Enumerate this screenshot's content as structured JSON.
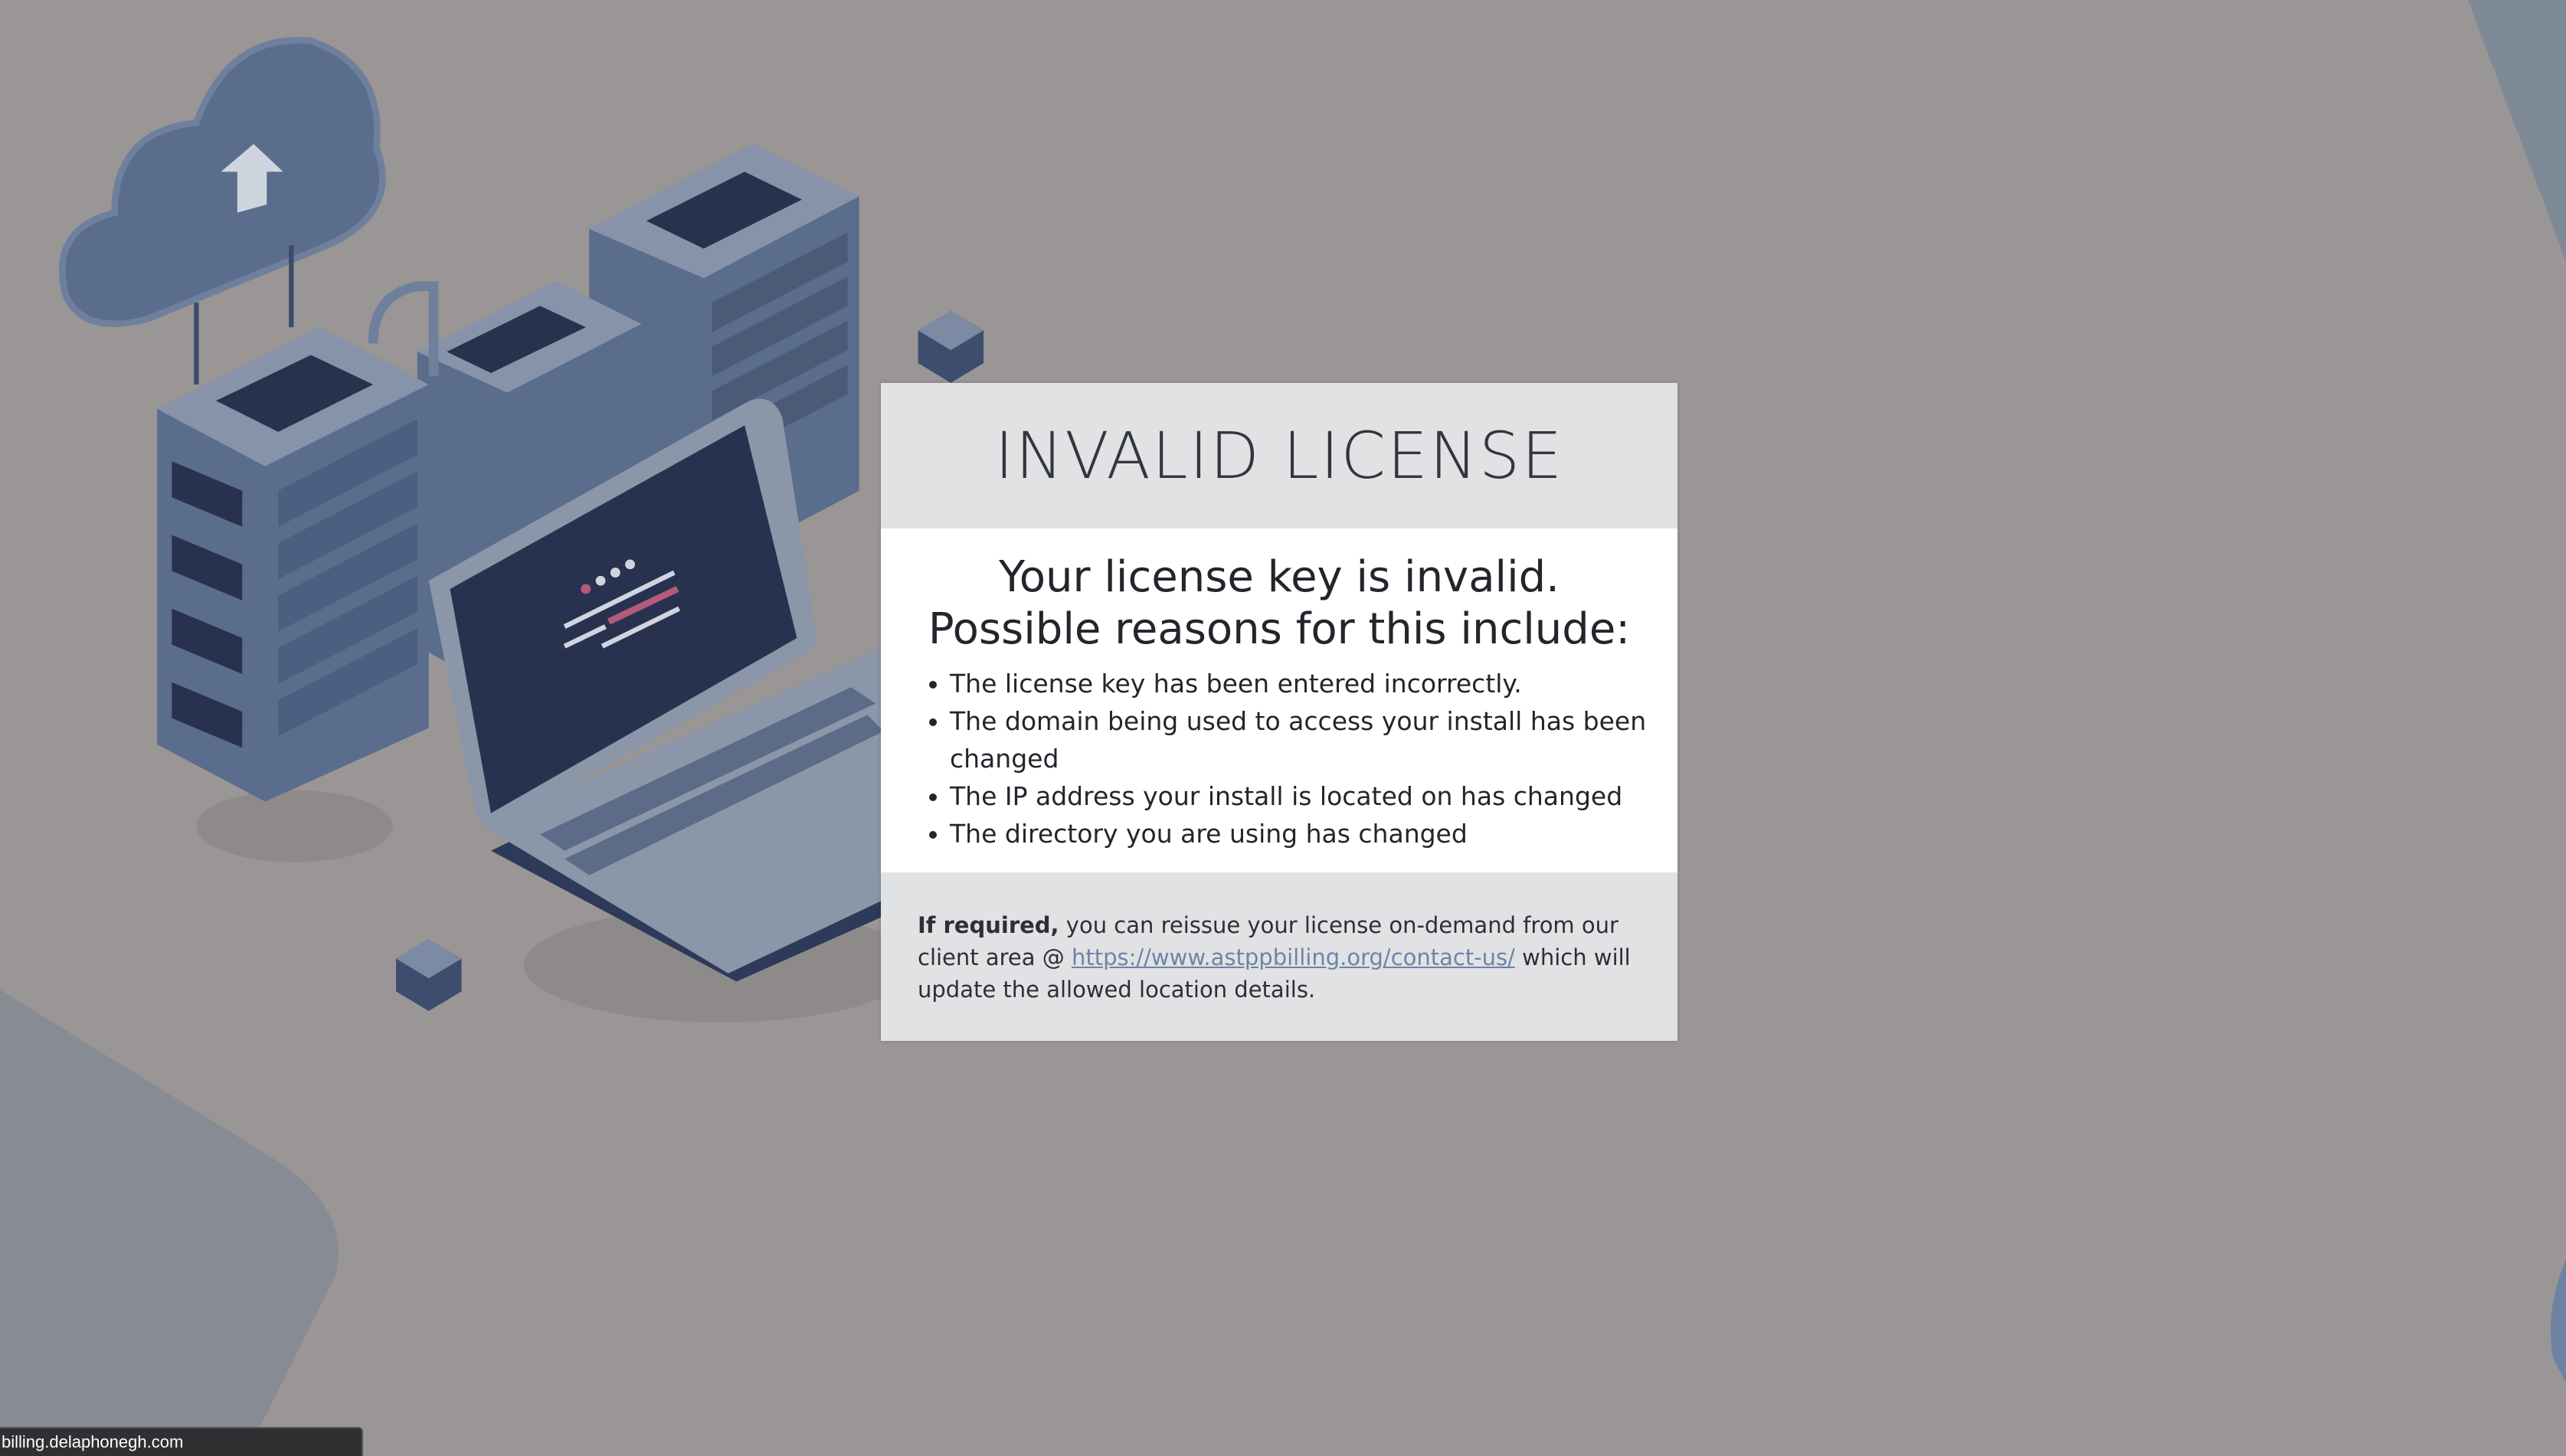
{
  "modal": {
    "title": "INVALID LICENSE",
    "subtitle_line1": "Your license key is invalid.",
    "subtitle_line2": "Possible reasons for this include:",
    "reasons": [
      "The license key has been entered incorrectly.",
      "The domain being used to access your install has been changed",
      "The IP address your install is located on has changed",
      "The directory you are using has changed"
    ],
    "footer": {
      "bold_prefix": "If required,",
      "text_before_link": " you can reissue your license on-demand from our client area @ ",
      "link_text": "https://www.astppbilling.org/contact-us/",
      "text_after_link": " which will update the allowed location details."
    }
  },
  "status_bar": {
    "url": "billing.delaphonegh.com"
  },
  "colors": {
    "background": "#9a9696",
    "panel_gray": "#e1e2e4",
    "link": "#6d84a8",
    "illustration_blue": "#5a6d8c",
    "illustration_dark": "#28324f"
  },
  "illustration": {
    "icons": [
      "cloud-upload-icon",
      "server-rack-icon",
      "laptop-icon",
      "cube-icon"
    ]
  }
}
